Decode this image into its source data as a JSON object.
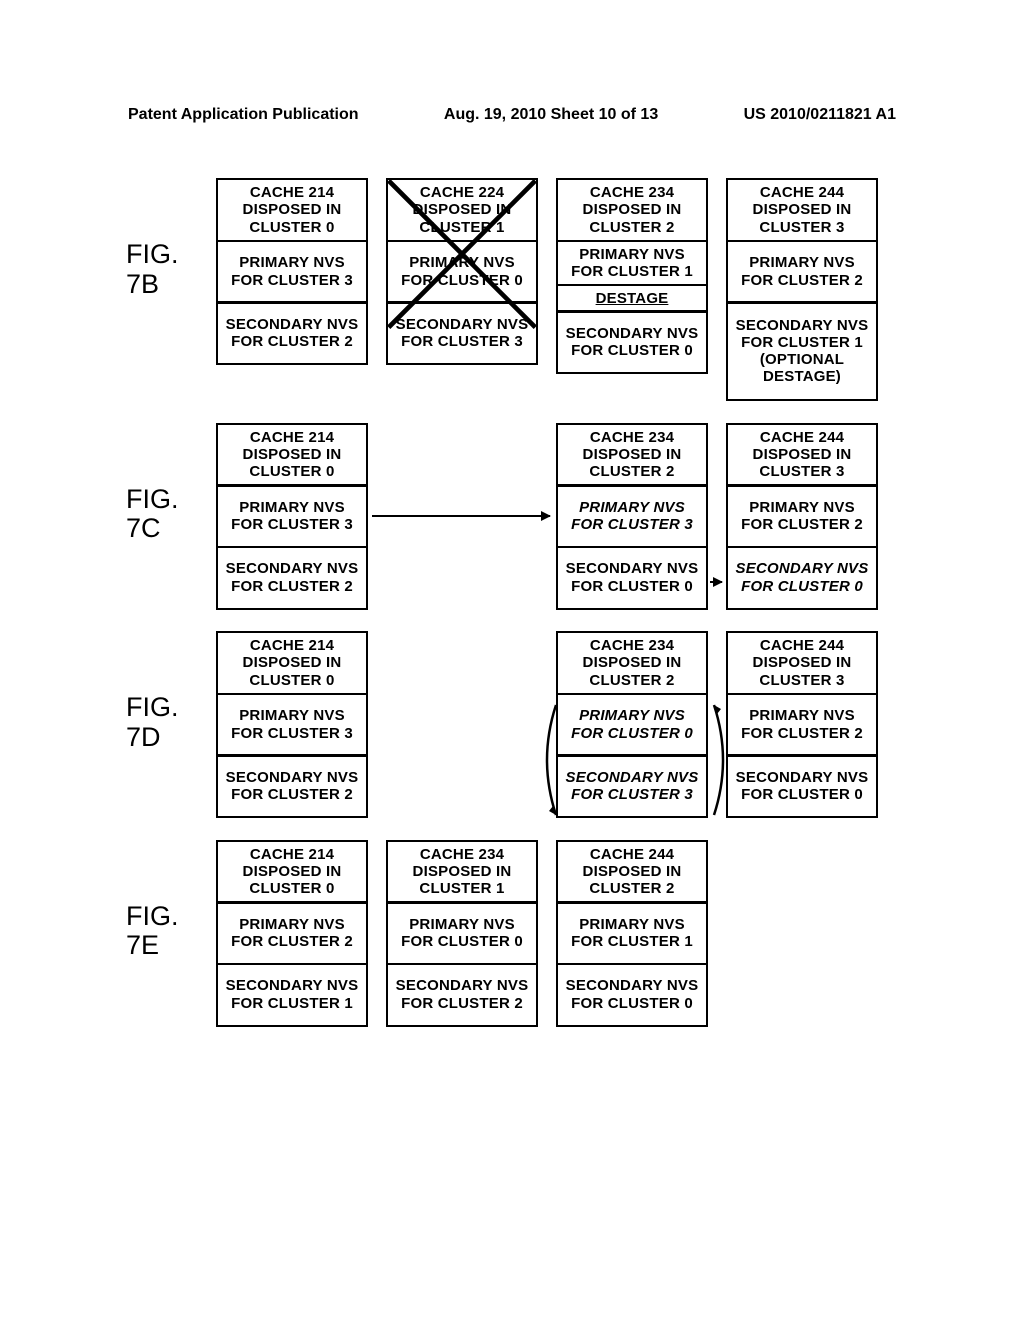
{
  "header": {
    "left": "Patent Application Publication",
    "mid": "Aug. 19, 2010  Sheet 10 of 13",
    "right": "US 2010/0211821 A1"
  },
  "figs": {
    "b": {
      "label1": "FIG.",
      "label2": "7B"
    },
    "c": {
      "label1": "FIG.",
      "label2": "7C"
    },
    "d": {
      "label1": "FIG.",
      "label2": "7D"
    },
    "e": {
      "label1": "FIG.",
      "label2": "7E"
    }
  },
  "b": {
    "c0": {
      "cache": "CACHE 214 DISPOSED IN CLUSTER 0",
      "pri": "PRIMARY NVS FOR CLUSTER 3",
      "sec": "SECONDARY NVS FOR CLUSTER 2"
    },
    "c1": {
      "cache": "CACHE 224 DISPOSED IN CLUSTER 1",
      "pri": "PRIMARY NVS FOR CLUSTER 0",
      "sec": "SECONDARY NVS FOR CLUSTER 3"
    },
    "c2": {
      "cache": "CACHE 234 DISPOSED IN CLUSTER 2",
      "pri": "PRIMARY NVS FOR CLUSTER 1",
      "destage": "DESTAGE",
      "sec": "SECONDARY NVS FOR CLUSTER 0"
    },
    "c3": {
      "cache": "CACHE 244 DISPOSED IN CLUSTER 3",
      "pri": "PRIMARY NVS FOR CLUSTER 2",
      "sec": "SECONDARY NVS FOR CLUSTER 1",
      "opt": "(OPTIONAL DESTAGE)"
    }
  },
  "c": {
    "c0": {
      "cache": "CACHE 214 DISPOSED IN CLUSTER 0",
      "pri": "PRIMARY NVS FOR CLUSTER 3",
      "sec": "SECONDARY NVS FOR CLUSTER 2"
    },
    "c2": {
      "cache": "CACHE 234 DISPOSED IN CLUSTER 2",
      "pri": "PRIMARY NVS FOR CLUSTER 3",
      "sec": "SECONDARY NVS FOR CLUSTER 0"
    },
    "c3": {
      "cache": "CACHE 244 DISPOSED IN CLUSTER 3",
      "pri": "PRIMARY NVS FOR CLUSTER 2",
      "sec": "SECONDARY NVS FOR CLUSTER 0"
    }
  },
  "d": {
    "c0": {
      "cache": "CACHE 214 DISPOSED IN CLUSTER 0",
      "pri": "PRIMARY NVS FOR CLUSTER 3",
      "sec": "SECONDARY NVS FOR CLUSTER 2"
    },
    "c2": {
      "cache": "CACHE 234 DISPOSED IN CLUSTER 2",
      "pri": "PRIMARY NVS FOR CLUSTER 0",
      "sec": "SECONDARY NVS FOR CLUSTER 3"
    },
    "c3": {
      "cache": "CACHE 244 DISPOSED IN CLUSTER 3",
      "pri": "PRIMARY NVS FOR CLUSTER 2",
      "sec": "SECONDARY NVS FOR CLUSTER 0"
    }
  },
  "e": {
    "c0": {
      "cache": "CACHE 214 DISPOSED IN CLUSTER 0",
      "pri": "PRIMARY NVS FOR CLUSTER 2",
      "sec": "SECONDARY NVS FOR CLUSTER 1"
    },
    "c1": {
      "cache": "CACHE 234 DISPOSED IN CLUSTER 1",
      "pri": "PRIMARY NVS FOR CLUSTER 0",
      "sec": "SECONDARY NVS FOR CLUSTER 2"
    },
    "c2": {
      "cache": "CACHE 244 DISPOSED IN CLUSTER 2",
      "pri": "PRIMARY NVS FOR CLUSTER 1",
      "sec": "SECONDARY NVS FOR CLUSTER 0"
    }
  }
}
